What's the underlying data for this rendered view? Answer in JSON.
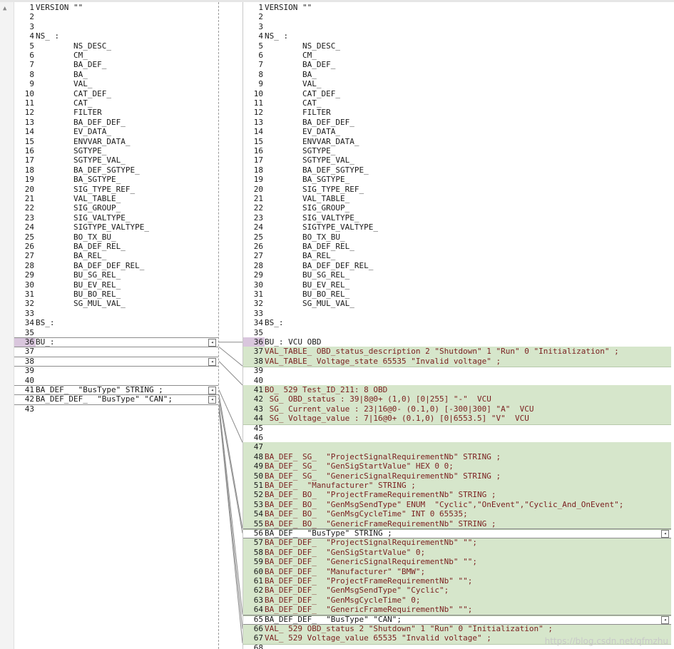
{
  "left": {
    "lines": [
      {
        "n": "1",
        "t": "VERSION \"\""
      },
      {
        "n": "2",
        "t": ""
      },
      {
        "n": "3",
        "t": ""
      },
      {
        "n": "4",
        "t": "NS_ :"
      },
      {
        "n": "5",
        "t": "        NS_DESC_"
      },
      {
        "n": "6",
        "t": "        CM_"
      },
      {
        "n": "7",
        "t": "        BA_DEF_"
      },
      {
        "n": "8",
        "t": "        BA_"
      },
      {
        "n": "9",
        "t": "        VAL_"
      },
      {
        "n": "10",
        "t": "        CAT_DEF_"
      },
      {
        "n": "11",
        "t": "        CAT_"
      },
      {
        "n": "12",
        "t": "        FILTER"
      },
      {
        "n": "13",
        "t": "        BA_DEF_DEF_"
      },
      {
        "n": "14",
        "t": "        EV_DATA_"
      },
      {
        "n": "15",
        "t": "        ENVVAR_DATA_"
      },
      {
        "n": "16",
        "t": "        SGTYPE_"
      },
      {
        "n": "17",
        "t": "        SGTYPE_VAL_"
      },
      {
        "n": "18",
        "t": "        BA_DEF_SGTYPE_"
      },
      {
        "n": "19",
        "t": "        BA_SGTYPE_"
      },
      {
        "n": "20",
        "t": "        SIG_TYPE_REF_"
      },
      {
        "n": "21",
        "t": "        VAL_TABLE_"
      },
      {
        "n": "22",
        "t": "        SIG_GROUP_"
      },
      {
        "n": "23",
        "t": "        SIG_VALTYPE_"
      },
      {
        "n": "24",
        "t": "        SIGTYPE_VALTYPE_"
      },
      {
        "n": "25",
        "t": "        BO_TX_BU_"
      },
      {
        "n": "26",
        "t": "        BA_DEF_REL_"
      },
      {
        "n": "27",
        "t": "        BA_REL_"
      },
      {
        "n": "28",
        "t": "        BA_DEF_DEF_REL_"
      },
      {
        "n": "29",
        "t": "        BU_SG_REL_"
      },
      {
        "n": "30",
        "t": "        BU_EV_REL_"
      },
      {
        "n": "31",
        "t": "        BU_BO_REL_"
      },
      {
        "n": "32",
        "t": "        SG_MUL_VAL_"
      },
      {
        "n": "33",
        "t": ""
      },
      {
        "n": "34",
        "t": "BS_:"
      },
      {
        "n": "35",
        "t": ""
      },
      {
        "n": "36",
        "t": "BU_:"
      },
      {
        "n": "37",
        "t": ""
      },
      {
        "n": "38",
        "t": ""
      },
      {
        "n": "39",
        "t": ""
      },
      {
        "n": "40",
        "t": ""
      },
      {
        "n": "41",
        "t": "BA_DEF_  \"BusType\" STRING ;"
      },
      {
        "n": "42",
        "t": "BA_DEF_DEF_  \"BusType\" \"CAN\";"
      },
      {
        "n": "43",
        "t": ""
      }
    ]
  },
  "right": {
    "lines": [
      {
        "n": "1",
        "t": "VERSION \"\""
      },
      {
        "n": "2",
        "t": ""
      },
      {
        "n": "3",
        "t": ""
      },
      {
        "n": "4",
        "t": "NS_ :"
      },
      {
        "n": "5",
        "t": "        NS_DESC_"
      },
      {
        "n": "6",
        "t": "        CM_"
      },
      {
        "n": "7",
        "t": "        BA_DEF_"
      },
      {
        "n": "8",
        "t": "        BA_"
      },
      {
        "n": "9",
        "t": "        VAL_"
      },
      {
        "n": "10",
        "t": "        CAT_DEF_"
      },
      {
        "n": "11",
        "t": "        CAT_"
      },
      {
        "n": "12",
        "t": "        FILTER"
      },
      {
        "n": "13",
        "t": "        BA_DEF_DEF_"
      },
      {
        "n": "14",
        "t": "        EV_DATA_"
      },
      {
        "n": "15",
        "t": "        ENVVAR_DATA_"
      },
      {
        "n": "16",
        "t": "        SGTYPE_"
      },
      {
        "n": "17",
        "t": "        SGTYPE_VAL_"
      },
      {
        "n": "18",
        "t": "        BA_DEF_SGTYPE_"
      },
      {
        "n": "19",
        "t": "        BA_SGTYPE_"
      },
      {
        "n": "20",
        "t": "        SIG_TYPE_REF_"
      },
      {
        "n": "21",
        "t": "        VAL_TABLE_"
      },
      {
        "n": "22",
        "t": "        SIG_GROUP_"
      },
      {
        "n": "23",
        "t": "        SIG_VALTYPE_"
      },
      {
        "n": "24",
        "t": "        SIGTYPE_VALTYPE_"
      },
      {
        "n": "25",
        "t": "        BO_TX_BU_"
      },
      {
        "n": "26",
        "t": "        BA_DEF_REL_"
      },
      {
        "n": "27",
        "t": "        BA_REL_"
      },
      {
        "n": "28",
        "t": "        BA_DEF_DEF_REL_"
      },
      {
        "n": "29",
        "t": "        BU_SG_REL_"
      },
      {
        "n": "30",
        "t": "        BU_EV_REL_"
      },
      {
        "n": "31",
        "t": "        BU_BO_REL_"
      },
      {
        "n": "32",
        "t": "        SG_MUL_VAL_"
      },
      {
        "n": "33",
        "t": ""
      },
      {
        "n": "34",
        "t": "BS_:"
      },
      {
        "n": "35",
        "t": ""
      },
      {
        "n": "36",
        "t": "BU_: VCU OBD"
      },
      {
        "n": "37",
        "t": "VAL_TABLE_ OBD_status_description 2 \"Shutdown\" 1 \"Run\" 0 \"Initialization\" ;"
      },
      {
        "n": "38",
        "t": "VAL_TABLE_ Voltage_state 65535 \"Invalid voltage\" ;"
      },
      {
        "n": "39",
        "t": ""
      },
      {
        "n": "40",
        "t": ""
      },
      {
        "n": "41",
        "t": "BO_ 529 Test_ID_211: 8 OBD"
      },
      {
        "n": "42",
        "t": " SG_ OBD_status : 39|8@0+ (1,0) [0|255] \"-\"  VCU"
      },
      {
        "n": "43",
        "t": " SG_ Current_value : 23|16@0- (0.1,0) [-300|300] \"A\"  VCU"
      },
      {
        "n": "44",
        "t": " SG_ Voltage_value : 7|16@0+ (0.1,0) [0|6553.5] \"V\"  VCU"
      },
      {
        "n": "45",
        "t": ""
      },
      {
        "n": "46",
        "t": ""
      },
      {
        "n": "47",
        "t": ""
      },
      {
        "n": "48",
        "t": "BA_DEF_ SG_  \"ProjectSignalRequirementNb\" STRING ;"
      },
      {
        "n": "49",
        "t": "BA_DEF_ SG_  \"GenSigStartValue\" HEX 0 0;"
      },
      {
        "n": "50",
        "t": "BA_DEF_ SG_  \"GenericSignalRequirementNb\" STRING ;"
      },
      {
        "n": "51",
        "t": "BA_DEF_  \"Manufacturer\" STRING ;"
      },
      {
        "n": "52",
        "t": "BA_DEF_ BO_  \"ProjectFrameRequirementNb\" STRING ;"
      },
      {
        "n": "53",
        "t": "BA_DEF_ BO_  \"GenMsgSendType\" ENUM  \"Cyclic\",\"OnEvent\",\"Cyclic_And_OnEvent\";"
      },
      {
        "n": "54",
        "t": "BA_DEF_ BO_  \"GenMsgCycleTime\" INT 0 65535;"
      },
      {
        "n": "55",
        "t": "BA_DEF_ BO_  \"GenericFrameRequirementNb\" STRING ;"
      },
      {
        "n": "56",
        "t": "BA_DEF_  \"BusType\" STRING ;"
      },
      {
        "n": "57",
        "t": "BA_DEF_DEF_  \"ProjectSignalRequirementNb\" \"\";"
      },
      {
        "n": "58",
        "t": "BA_DEF_DEF_  \"GenSigStartValue\" 0;"
      },
      {
        "n": "59",
        "t": "BA_DEF_DEF_  \"GenericSignalRequirementNb\" \"\";"
      },
      {
        "n": "60",
        "t": "BA_DEF_DEF_  \"Manufacturer\" \"BMW\";"
      },
      {
        "n": "61",
        "t": "BA_DEF_DEF_  \"ProjectFrameRequirementNb\" \"\";"
      },
      {
        "n": "62",
        "t": "BA_DEF_DEF_  \"GenMsgSendType\" \"Cyclic\";"
      },
      {
        "n": "63",
        "t": "BA_DEF_DEF_  \"GenMsgCycleTime\" 0;"
      },
      {
        "n": "64",
        "t": "BA_DEF_DEF_  \"GenericFrameRequirementNb\" \"\";"
      },
      {
        "n": "65",
        "t": "BA_DEF_DEF_  \"BusType\" \"CAN\";"
      },
      {
        "n": "66",
        "t": "VAL_ 529 OBD_status 2 \"Shutdown\" 1 \"Run\" 0 \"Initialization\" ;"
      },
      {
        "n": "67",
        "t": "VAL_ 529 Voltage_value 65535 \"Invalid voltage\" ;"
      },
      {
        "n": "68",
        "t": ""
      }
    ],
    "green_ranges": [
      [
        37,
        38
      ],
      [
        41,
        44
      ],
      [
        47,
        55
      ],
      [
        57,
        64
      ],
      [
        66,
        67
      ]
    ]
  },
  "watermark": "https://blog.csdn.net/qfmzhu",
  "colors": {
    "diff_green": "#d6e6cb",
    "diff_text": "#7a1f1f",
    "line_highlight": "#d9c6dd"
  }
}
